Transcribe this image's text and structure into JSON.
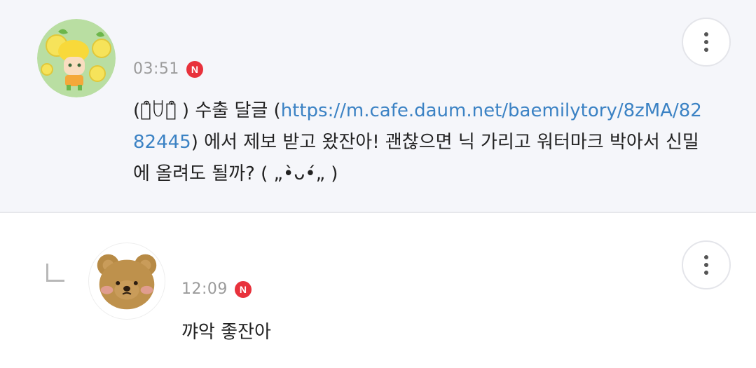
{
  "comments": [
    {
      "time": "03:51",
      "badge": "N",
      "text_before_link": "(꒪͒ꇴ꒪͒ ) 수출 달글 (",
      "link": "https://m.cafe.daum.net/baemilytory/8zMA/8282445",
      "text_after_link": ") 에서 제보 받고 왔잔아! 괜찮으면 닉 가리고 워터마크 박아서 신밀에 올려도 될까? ( „•̀ᴗ•́„ )",
      "avatar_icon": "lemon-character-avatar",
      "more_icon": "more-vertical-icon"
    },
    {
      "time": "12:09",
      "badge": "N",
      "text": "꺄악 좋잔아",
      "avatar_icon": "bear-avatar",
      "reply_icon": "reply-indent-icon",
      "more_icon": "more-vertical-icon"
    }
  ],
  "colors": {
    "main_bg": "#f5f6fa",
    "link": "#3b82c4",
    "badge": "#e8323c",
    "time": "#9b9b9b"
  }
}
